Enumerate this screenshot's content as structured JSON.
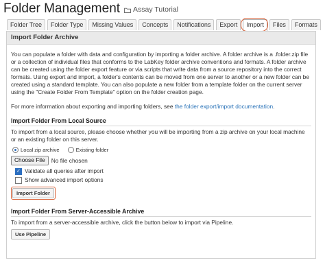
{
  "header": {
    "title": "Folder Management",
    "folder": "Assay Tutorial"
  },
  "tabs": [
    {
      "label": "Folder Tree"
    },
    {
      "label": "Folder Type"
    },
    {
      "label": "Missing Values"
    },
    {
      "label": "Concepts"
    },
    {
      "label": "Notifications"
    },
    {
      "label": "Export"
    },
    {
      "label": "Import"
    },
    {
      "label": "Files"
    },
    {
      "label": "Formats"
    }
  ],
  "active_tab": "Import",
  "panel": {
    "title": "Import Folder Archive",
    "intro": "You can populate a folder with data and configuration by importing a folder archive. A folder archive is a .folder.zip file or a collection of individual files that conforms to the LabKey folder archive conventions and formats. A folder archive can be created using the folder export feature or via scripts that write data from a source repository into the correct formats. Using export and import, a folder's contents can be moved from one server to another or a new folder can be created using a standard template. You can also populate a new folder from a template folder on the current server using the \"Create Folder From Template\" option on the folder creation page.",
    "more_info_prefix": "For more information about exporting and importing folders, see ",
    "more_info_link": "the folder export/import documentation",
    "more_info_suffix": ".",
    "local": {
      "title": "Import Folder From Local Source",
      "desc": "To import from a local source, please choose whether you will be importing from a zip archive on your local machine or an existing folder on this server.",
      "radio_zip": "Local zip archive",
      "radio_existing": "Existing folder",
      "choose_file": "Choose File",
      "no_file": "No file chosen",
      "validate": "Validate all queries after import",
      "advanced": "Show advanced import options",
      "import_button": "Import Folder"
    },
    "server": {
      "title": "Import Folder From Server-Accessible Archive",
      "desc": "To import from a server-accessible archive, click the button below to import via Pipeline.",
      "pipeline_button": "Use Pipeline"
    }
  },
  "colors": {
    "highlight": "#d9633a",
    "link": "#2a73b8",
    "accent": "#2d6fc0"
  }
}
